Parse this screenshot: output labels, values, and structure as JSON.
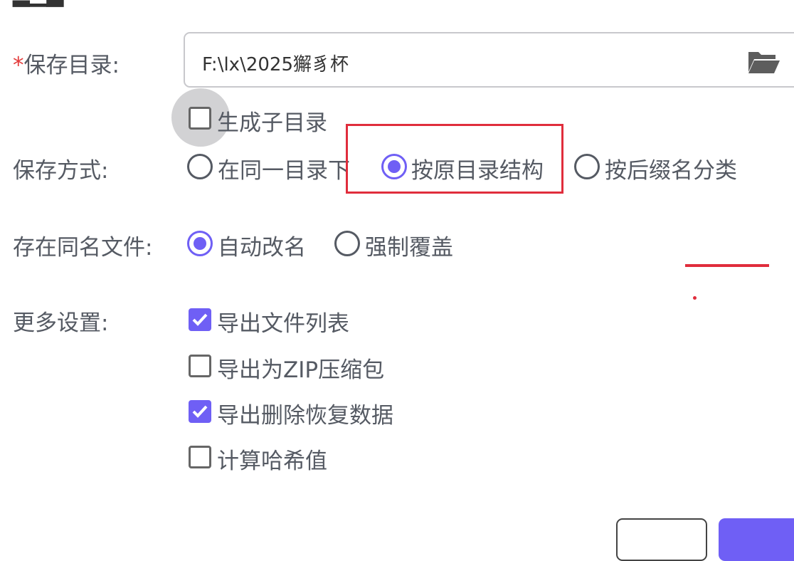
{
  "colors": {
    "accent": "#6f5ff5",
    "required": "#e33b3b",
    "annotation": "#e02d3c"
  },
  "save_dir": {
    "required_mark": "*",
    "label": "保存目录:",
    "value": "F:\\lx\\2025獬豸杯",
    "icon": "folder-open-icon",
    "subdir": {
      "label": "生成子目录",
      "checked": false
    }
  },
  "save_mode": {
    "label": "保存方式:",
    "options": [
      {
        "label": "在同一目录下",
        "selected": false
      },
      {
        "label": "按原目录结构",
        "selected": true
      },
      {
        "label": "按后缀名分类",
        "selected": false
      }
    ]
  },
  "same_name": {
    "label": "存在同名文件:",
    "options": [
      {
        "label": "自动改名",
        "selected": true
      },
      {
        "label": "强制覆盖",
        "selected": false
      }
    ]
  },
  "more": {
    "label": "更多设置:",
    "items": [
      {
        "label": "导出文件列表",
        "checked": true
      },
      {
        "label": "导出为ZIP压缩包",
        "checked": false
      },
      {
        "label": "导出删除恢复数据",
        "checked": true
      },
      {
        "label": "计算哈希值",
        "checked": false
      }
    ]
  }
}
